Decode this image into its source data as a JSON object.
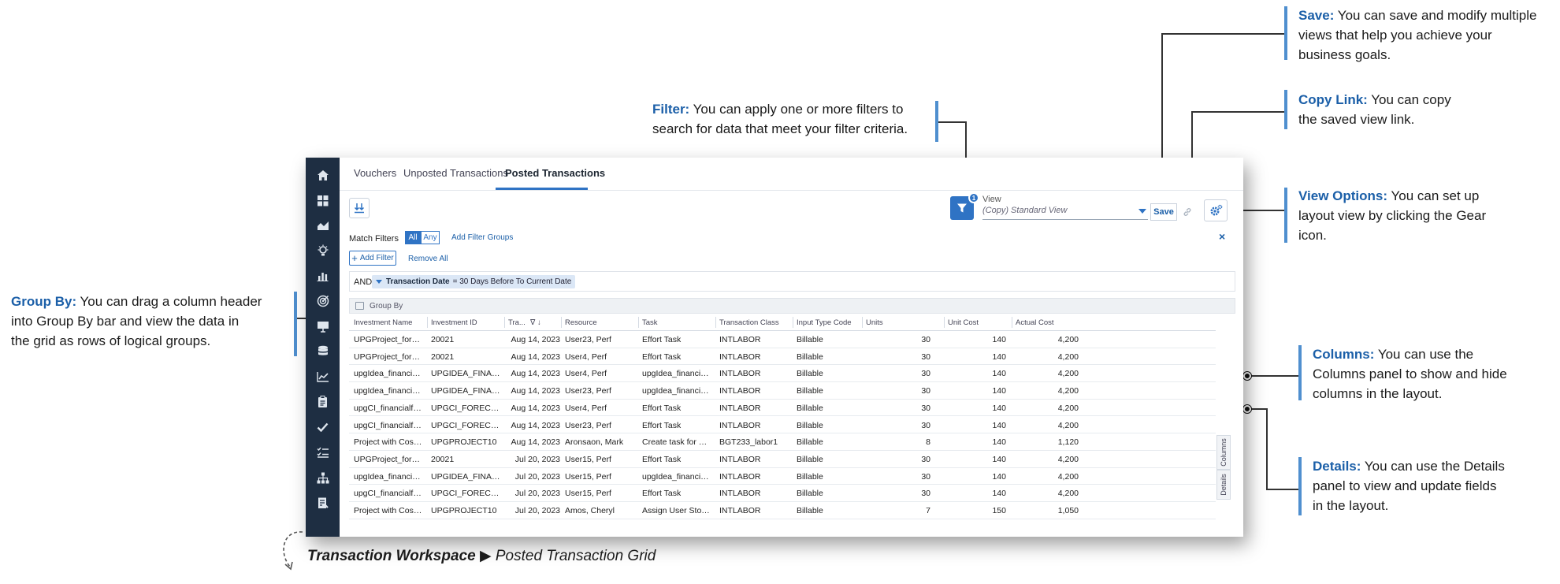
{
  "callouts": {
    "save": {
      "title": "Save:",
      "line1": "You can save and modify multiple",
      "line2": "views that help you achieve your",
      "line3": "business goals."
    },
    "copy_link": {
      "title": "Copy Link:",
      "line1": "You can copy",
      "line2": "the saved view link."
    },
    "filter": {
      "title": "Filter:",
      "line1": "You can apply one or more filters to",
      "line2": "search for data that meet your filter criteria."
    },
    "view_options": {
      "title": "View Options:",
      "line1": "You can set up",
      "line2": "layout view by clicking the Gear",
      "line3": "icon."
    },
    "group_by": {
      "title": "Group By:",
      "line1": "You can drag a column header",
      "line2": "into Group By bar and view the data in",
      "line3": "the grid as rows of logical groups."
    },
    "columns": {
      "title": "Columns:",
      "line1": "You can use the",
      "line2": "Columns panel to show and hide",
      "line3": "columns in the layout."
    },
    "details": {
      "title": "Details:",
      "line1": "You can use the Details",
      "line2": "panel to view and update fields",
      "line3": "in the layout."
    }
  },
  "tabs": [
    {
      "label": "Vouchers"
    },
    {
      "label": "Unposted Transactions"
    },
    {
      "label": "Posted Transactions",
      "active": true
    }
  ],
  "toolbar": {
    "filter_count": "1",
    "view_label": "View",
    "view_value": "(Copy) Standard View",
    "save_label": "Save"
  },
  "filters": {
    "match_label": "Match Filters",
    "all_label": "All",
    "any_label": "Any",
    "add_group_label": "Add Filter Groups",
    "add_filter_label": "Add Filter",
    "remove_all_label": "Remove All",
    "close_label": "×",
    "operator": "AND",
    "chip_field": "Transaction Date",
    "chip_value": "= 30 Days Before To Current Date"
  },
  "group_by_label": "Group By",
  "grid": {
    "columns": [
      "Investment Name",
      "Investment ID",
      "Tra...",
      "Resource",
      "Task",
      "Transaction Class",
      "Input Type Code",
      "Units",
      "Unit Cost",
      "Actual Cost"
    ],
    "rows": [
      [
        "UPGProject_forFor...",
        "20021",
        "Aug 14, 2023",
        "User23, Perf",
        "Effort Task",
        "INTLABOR",
        "Billable",
        "30",
        "140",
        "4,200"
      ],
      [
        "UPGProject_forFor...",
        "20021",
        "Aug 14, 2023",
        "User4, Perf",
        "Effort Task",
        "INTLABOR",
        "Billable",
        "30",
        "140",
        "4,200"
      ],
      [
        "upgIdea_financials...",
        "UPGIDEA_FINANCI...",
        "Aug 14, 2023",
        "User4, Perf",
        "upgIdea_financials...",
        "INTLABOR",
        "Billable",
        "30",
        "140",
        "4,200"
      ],
      [
        "upgIdea_financials...",
        "UPGIDEA_FINANCI...",
        "Aug 14, 2023",
        "User23, Perf",
        "upgIdea_financials...",
        "INTLABOR",
        "Billable",
        "30",
        "140",
        "4,200"
      ],
      [
        "upgCI_financialfore...",
        "UPGCI_FORECAST",
        "Aug 14, 2023",
        "User4, Perf",
        "Effort Task",
        "INTLABOR",
        "Billable",
        "30",
        "140",
        "4,200"
      ],
      [
        "upgCI_financialfore...",
        "UPGCI_FORECAST",
        "Aug 14, 2023",
        "User23, Perf",
        "Effort Task",
        "INTLABOR",
        "Billable",
        "30",
        "140",
        "4,200"
      ],
      [
        "Project with Cost Pl...",
        "UPGPROJECT10",
        "Aug 14, 2023",
        "Aronsaon, Mark",
        "Create task for Uni...",
        "BGT233_labor1",
        "Billable",
        "8",
        "140",
        "1,120"
      ],
      [
        "UPGProject_forFor...",
        "20021",
        "Jul 20, 2023",
        "User15, Perf",
        "Effort Task",
        "INTLABOR",
        "Billable",
        "30",
        "140",
        "4,200"
      ],
      [
        "upgIdea_financials...",
        "UPGIDEA_FINANCI...",
        "Jul 20, 2023",
        "User15, Perf",
        "upgIdea_financials...",
        "INTLABOR",
        "Billable",
        "30",
        "140",
        "4,200"
      ],
      [
        "upgCI_financialfore...",
        "UPGCI_FORECAST",
        "Jul 20, 2023",
        "User15, Perf",
        "Effort Task",
        "INTLABOR",
        "Billable",
        "30",
        "140",
        "4,200"
      ],
      [
        "Project with Cost Pl...",
        "UPGPROJECT10",
        "Jul 20, 2023",
        "Amos, Cheryl",
        "Assign User Stories...",
        "INTLABOR",
        "Billable",
        "7",
        "150",
        "1,050"
      ]
    ]
  },
  "side_panels": {
    "columns_label": "Columns",
    "details_label": "Details"
  },
  "caption": {
    "bold": "Transaction Workspace",
    "arrow": "▶",
    "rest": "Posted Transaction Grid"
  },
  "colors": {
    "accent": "#2f73c4",
    "sidebar": "#1e2e42",
    "callout_title": "#1b5fa8",
    "callout_bar": "#4f8fcf"
  }
}
